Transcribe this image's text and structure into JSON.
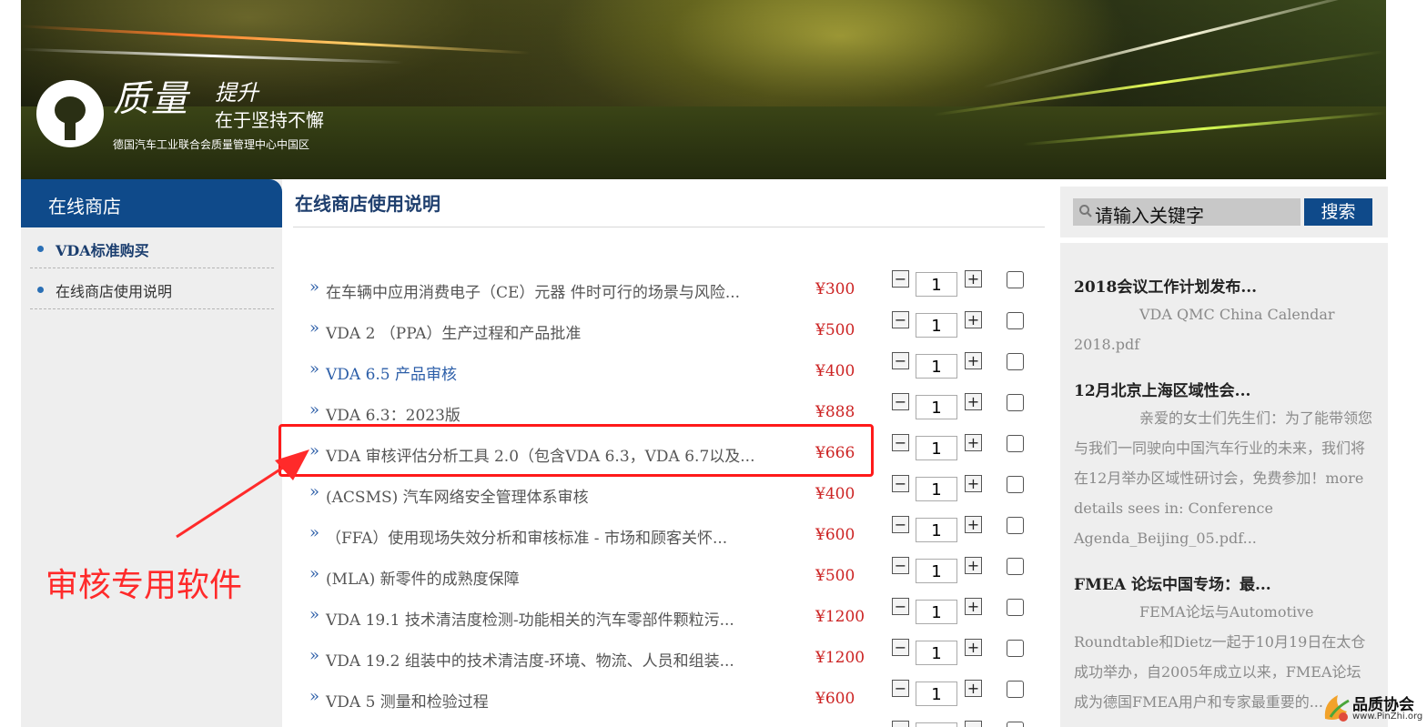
{
  "banner": {
    "brand_main": "质量",
    "brand_upgrade": "提升",
    "tagline": "在于坚持不懈",
    "subtitle": "德国汽车工业联合会质量管理中心中国区"
  },
  "sidebar": {
    "header": "在线商店",
    "items": [
      {
        "label": "VDA标准购买"
      },
      {
        "label": "在线商店使用说明"
      }
    ]
  },
  "main": {
    "title": "在线商店使用说明",
    "products": [
      {
        "raquo": "»",
        "name": "在车辆中应用消费电子（CE）元器 件时可行的场景与风险...",
        "price": "¥300",
        "qty": "1"
      },
      {
        "raquo": "»",
        "name": "VDA 2 （PPA）生产过程和产品批准",
        "price": "¥500",
        "qty": "1"
      },
      {
        "raquo": "»",
        "name": "VDA 6.5 产品审核",
        "price": "¥400",
        "qty": "1"
      },
      {
        "raquo": "»",
        "name": "VDA 6.3：2023版",
        "price": "¥888",
        "qty": "1"
      },
      {
        "raquo": "»",
        "name": "VDA 审核评估分析工具 2.0（包含VDA 6.3，VDA 6.7以及...",
        "price": "¥666",
        "qty": "1"
      },
      {
        "raquo": "»",
        "name": "(ACSMS) 汽车网络安全管理体系审核",
        "price": "¥400",
        "qty": "1"
      },
      {
        "raquo": "»",
        "name": "（FFA）使用现场失效分析和审核标准 - 市场和顾客关怀...",
        "price": "¥600",
        "qty": "1"
      },
      {
        "raquo": "»",
        "name": "(MLA) 新零件的成熟度保障",
        "price": "¥500",
        "qty": "1"
      },
      {
        "raquo": "»",
        "name": "VDA 19.1 技术清洁度检测-功能相关的汽车零部件颗粒污...",
        "price": "¥1200",
        "qty": "1"
      },
      {
        "raquo": "»",
        "name": "VDA 19.2 组装中的技术清洁度-环境、物流、人员和组装...",
        "price": "¥1200",
        "qty": "1"
      },
      {
        "raquo": "»",
        "name": "VDA 5 测量和检验过程",
        "price": "¥600",
        "qty": "1"
      }
    ],
    "minus": "−",
    "plus": "+"
  },
  "annotation": "审核专用软件",
  "search": {
    "placeholder": "请输入关键字",
    "button": "搜索"
  },
  "news": [
    {
      "title": "2018会议工作计划发布...",
      "body": "VDA QMC China Calendar 2018.pdf"
    },
    {
      "title": "12月北京上海区域性会...",
      "body": "亲爱的女士们先生们：为了能带领您与我们一同驶向中国汽车行业的未来，我们将在12月举办区域性研讨会，免费参加！more details sees in: Conference Agenda_Beijing_05.pdf..."
    },
    {
      "title": "FMEA 论坛中国专场：最...",
      "body": "FEMA论坛与Automotive Roundtable和Dietz一起于10月19日在太仓成功举办，自2005年成立以来，FMEA论坛成为德国FMEA用户和专家最重要的..."
    }
  ],
  "watermark": {
    "name": "品质协会",
    "url": "www.PinZhi.org"
  }
}
